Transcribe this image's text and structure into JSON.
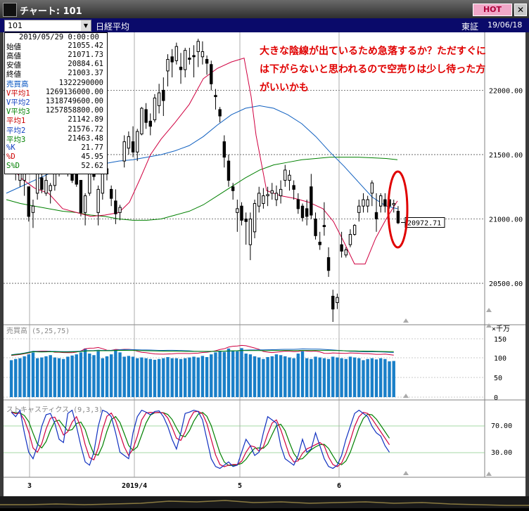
{
  "window": {
    "title": "チャート: 101",
    "hot_label": "HOT",
    "close_label": "✕"
  },
  "toolbar": {
    "code": "101",
    "name": "日経平均",
    "market": "東証",
    "date": "19/06/18"
  },
  "info": {
    "date": "2019/05/29 0:00:00",
    "rows": [
      {
        "label": "始値",
        "value": "21055.42",
        "color": "#000000"
      },
      {
        "label": "高値",
        "value": "21071.73",
        "color": "#000000"
      },
      {
        "label": "安値",
        "value": "20884.61",
        "color": "#000000"
      },
      {
        "label": "終値",
        "value": "21003.37",
        "color": "#000000"
      },
      {
        "label": "売買高",
        "value": "1322290000",
        "color": "#0050c0"
      },
      {
        "label": "V平均1",
        "value": "1269136000.00",
        "color": "#cc0000"
      },
      {
        "label": "V平均2",
        "value": "1318749600.00",
        "color": "#1040c0"
      },
      {
        "label": "V平均3",
        "value": "1257858800.00",
        "color": "#008000"
      },
      {
        "label": "平均1",
        "value": "21142.89",
        "color": "#cc0000"
      },
      {
        "label": "平均2",
        "value": "21576.72",
        "color": "#1040c0"
      },
      {
        "label": "平均3",
        "value": "21463.48",
        "color": "#008000"
      },
      {
        "label": "%K",
        "value": "21.77",
        "color": "#1040c0"
      },
      {
        "label": "%D",
        "value": "45.95",
        "color": "#cc0000"
      },
      {
        "label": "S%D",
        "value": "52.62",
        "color": "#008000"
      }
    ]
  },
  "annotation": {
    "text": "大きな陰線が出ているため急落するか？ただすぐには下がらないと思われるので空売りは少し待った方がいいかも",
    "color": "#e00000"
  },
  "chart_data": {
    "type": "candlestick",
    "price_axis": {
      "ticks": [
        "22000.00",
        "21500.00",
        "21000.00",
        "20500.00"
      ],
      "ylim": [
        20200,
        22450
      ]
    },
    "last_price": "20972.71",
    "x_labels": [
      "3",
      "2019/4",
      "5",
      "6"
    ],
    "volume_panel": {
      "label": "売買高 (5,25,75)",
      "unit": "×千万",
      "ticks": [
        "150",
        "100",
        "50",
        "0"
      ]
    },
    "stoch_panel": {
      "label": "ストキャスティクス (9,3,3)",
      "ticks": [
        "70.00",
        "30.00"
      ]
    },
    "candles": [
      [
        21650,
        21700,
        21420,
        21450
      ],
      [
        21430,
        21500,
        21300,
        21350
      ],
      [
        21300,
        21400,
        21250,
        21380
      ],
      [
        21300,
        21420,
        21180,
        21350
      ],
      [
        21250,
        21250,
        20980,
        21020
      ],
      [
        21050,
        21150,
        20930,
        21100
      ],
      [
        21200,
        21450,
        21150,
        21400
      ],
      [
        21320,
        21350,
        21200,
        21230
      ],
      [
        21200,
        21380,
        21180,
        21300
      ],
      [
        21220,
        21280,
        21120,
        21260
      ],
      [
        21260,
        21470,
        21220,
        21450
      ],
      [
        21420,
        21500,
        21330,
        21350
      ],
      [
        21460,
        21600,
        21400,
        21560
      ],
      [
        21450,
        21500,
        21330,
        21360
      ],
      [
        21400,
        21420,
        21280,
        21300
      ],
      [
        21400,
        21450,
        21250,
        21270
      ],
      [
        21300,
        21300,
        21020,
        21050
      ],
      [
        21050,
        21200,
        20950,
        21180
      ],
      [
        21200,
        21400,
        21180,
        21380
      ],
      [
        21380,
        21450,
        21300,
        21330
      ],
      [
        21050,
        21260,
        20950,
        21230
      ],
      [
        21200,
        21380,
        21150,
        21350
      ],
      [
        21350,
        21420,
        21300,
        21390
      ],
      [
        21230,
        21260,
        21100,
        21160
      ],
      [
        21140,
        21230,
        20960,
        21040
      ],
      [
        21050,
        21110,
        20990,
        21090
      ],
      [
        21450,
        21650,
        21400,
        21600
      ],
      [
        21550,
        21680,
        21500,
        21640
      ],
      [
        21600,
        21720,
        21480,
        21520
      ],
      [
        21520,
        21700,
        21450,
        21680
      ],
      [
        21660,
        21870,
        21650,
        21860
      ],
      [
        21850,
        21900,
        21700,
        21750
      ],
      [
        21760,
        21820,
        21650,
        21720
      ],
      [
        21770,
        21970,
        21750,
        21940
      ],
      [
        21880,
        22050,
        21820,
        21980
      ],
      [
        22000,
        22100,
        21800,
        21920
      ],
      [
        22150,
        22280,
        22030,
        22240
      ],
      [
        22260,
        22320,
        22100,
        22220
      ],
      [
        22230,
        22370,
        22200,
        22340
      ],
      [
        22180,
        22290,
        22050,
        22160
      ],
      [
        22160,
        22330,
        22100,
        22310
      ],
      [
        22250,
        22330,
        22200,
        22240
      ],
      [
        22270,
        22350,
        22100,
        22260
      ],
      [
        22300,
        22400,
        22180,
        22380
      ],
      [
        22260,
        22380,
        22200,
        22300
      ],
      [
        22240,
        22270,
        22120,
        22210
      ],
      [
        22200,
        22230,
        22000,
        22050
      ],
      [
        21960,
        22010,
        21850,
        21950
      ],
      [
        21850,
        21870,
        21750,
        21800
      ],
      [
        21600,
        21650,
        21400,
        21480
      ],
      [
        21450,
        21500,
        21250,
        21300
      ],
      [
        21250,
        21280,
        21150,
        21220
      ],
      [
        21050,
        21150,
        20900,
        21080
      ],
      [
        21100,
        21130,
        20950,
        20990
      ],
      [
        21000,
        21050,
        20800,
        20980
      ],
      [
        20800,
        21050,
        20680,
        21000
      ],
      [
        20900,
        21150,
        20850,
        21120
      ],
      [
        21100,
        21250,
        21050,
        21200
      ],
      [
        21120,
        21240,
        21080,
        21180
      ],
      [
        21180,
        21250,
        21100,
        21190
      ],
      [
        21200,
        21280,
        21150,
        21220
      ],
      [
        21150,
        21260,
        21100,
        21200
      ],
      [
        21180,
        21300,
        21120,
        21230
      ],
      [
        21300,
        21420,
        21250,
        21380
      ],
      [
        21300,
        21380,
        21220,
        21340
      ],
      [
        21260,
        21300,
        21150,
        21230
      ],
      [
        21150,
        21200,
        21040,
        21080
      ],
      [
        21100,
        21120,
        20980,
        21010
      ],
      [
        21080,
        21150,
        20950,
        21020
      ],
      [
        21250,
        21350,
        21000,
        21030
      ],
      [
        21000,
        21050,
        20840,
        20870
      ],
      [
        20820,
        20900,
        20760,
        20800
      ],
      [
        20950,
        21130,
        20870,
        20940
      ],
      [
        20700,
        20780,
        20550,
        20600
      ],
      [
        20400,
        20450,
        20200,
        20300
      ],
      [
        20350,
        20420,
        20300,
        20390
      ],
      [
        20800,
        20900,
        20700,
        20750
      ],
      [
        20720,
        20780,
        20700,
        20760
      ],
      [
        20800,
        20920,
        20780,
        20880
      ],
      [
        20880,
        20960,
        20870,
        20950
      ],
      [
        21050,
        21150,
        20980,
        21100
      ],
      [
        21100,
        21200,
        21050,
        21150
      ],
      [
        21100,
        21180,
        21050,
        21150
      ],
      [
        21200,
        21300,
        21100,
        21280
      ],
      [
        21050,
        21200,
        20900,
        21000
      ],
      [
        21100,
        21200,
        21050,
        21180
      ],
      [
        21150,
        21200,
        21050,
        21100
      ],
      [
        21150,
        21200,
        21080,
        21100
      ],
      [
        21110,
        21150,
        21050,
        21120
      ],
      [
        21060,
        21100,
        20960,
        20970
      ]
    ],
    "ma1": [
      [
        0,
        21470
      ],
      [
        20,
        21320
      ],
      [
        40,
        21240
      ],
      [
        60,
        21200
      ],
      [
        80,
        21080
      ],
      [
        100,
        21050
      ],
      [
        120,
        21020
      ],
      [
        140,
        21030
      ],
      [
        160,
        21050
      ],
      [
        175,
        21130
      ],
      [
        190,
        21310
      ],
      [
        205,
        21500
      ],
      [
        220,
        21620
      ],
      [
        240,
        21750
      ],
      [
        260,
        21890
      ],
      [
        280,
        22090
      ],
      [
        300,
        22170
      ],
      [
        320,
        22220
      ],
      [
        338,
        22250
      ],
      [
        348,
        21950
      ],
      [
        355,
        21650
      ],
      [
        370,
        21220
      ],
      [
        390,
        21180
      ],
      [
        410,
        21160
      ],
      [
        430,
        21130
      ],
      [
        450,
        21080
      ],
      [
        465,
        20980
      ],
      [
        480,
        20820
      ],
      [
        495,
        20650
      ],
      [
        510,
        20650
      ],
      [
        525,
        20850
      ],
      [
        540,
        21000
      ],
      [
        556,
        21140
      ]
    ],
    "ma2": [
      [
        0,
        21200
      ],
      [
        20,
        21250
      ],
      [
        40,
        21300
      ],
      [
        60,
        21350
      ],
      [
        80,
        21380
      ],
      [
        100,
        21400
      ],
      [
        120,
        21420
      ],
      [
        140,
        21430
      ],
      [
        160,
        21450
      ],
      [
        180,
        21460
      ],
      [
        200,
        21480
      ],
      [
        220,
        21500
      ],
      [
        240,
        21530
      ],
      [
        260,
        21570
      ],
      [
        280,
        21640
      ],
      [
        300,
        21730
      ],
      [
        320,
        21810
      ],
      [
        340,
        21860
      ],
      [
        360,
        21880
      ],
      [
        380,
        21860
      ],
      [
        400,
        21810
      ],
      [
        420,
        21740
      ],
      [
        440,
        21640
      ],
      [
        460,
        21520
      ],
      [
        480,
        21410
      ],
      [
        500,
        21290
      ],
      [
        520,
        21170
      ],
      [
        540,
        21100
      ],
      [
        556,
        21080
      ]
    ],
    "ma3": [
      [
        0,
        21150
      ],
      [
        20,
        21120
      ],
      [
        40,
        21100
      ],
      [
        60,
        21080
      ],
      [
        80,
        21060
      ],
      [
        100,
        21050
      ],
      [
        120,
        21030
      ],
      [
        140,
        21020
      ],
      [
        160,
        21000
      ],
      [
        180,
        20990
      ],
      [
        200,
        20990
      ],
      [
        220,
        21000
      ],
      [
        240,
        21030
      ],
      [
        260,
        21060
      ],
      [
        280,
        21110
      ],
      [
        300,
        21180
      ],
      [
        320,
        21250
      ],
      [
        340,
        21320
      ],
      [
        360,
        21380
      ],
      [
        380,
        21420
      ],
      [
        400,
        21440
      ],
      [
        420,
        21460
      ],
      [
        440,
        21470
      ],
      [
        460,
        21480
      ],
      [
        480,
        21480
      ],
      [
        500,
        21480
      ],
      [
        520,
        21475
      ],
      [
        540,
        21470
      ],
      [
        556,
        21460
      ]
    ],
    "volumes": [
      95,
      98,
      100,
      105,
      110,
      115,
      100,
      102,
      105,
      108,
      102,
      100,
      98,
      104,
      107,
      110,
      115,
      125,
      112,
      108,
      118,
      100,
      105,
      110,
      120,
      115,
      104,
      106,
      104,
      100,
      102,
      100,
      98,
      96,
      98,
      100,
      103,
      100,
      100,
      98,
      100,
      102,
      104,
      102,
      106,
      103,
      110,
      115,
      118,
      116,
      125,
      120,
      118,
      126,
      112,
      110,
      105,
      102,
      98,
      103,
      105,
      110,
      108,
      105,
      102,
      100,
      112,
      118,
      100,
      98,
      104,
      102,
      100,
      98,
      104,
      102,
      100,
      98,
      104,
      102,
      100,
      95,
      98,
      100,
      97,
      100,
      98,
      92,
      93
    ]
  }
}
